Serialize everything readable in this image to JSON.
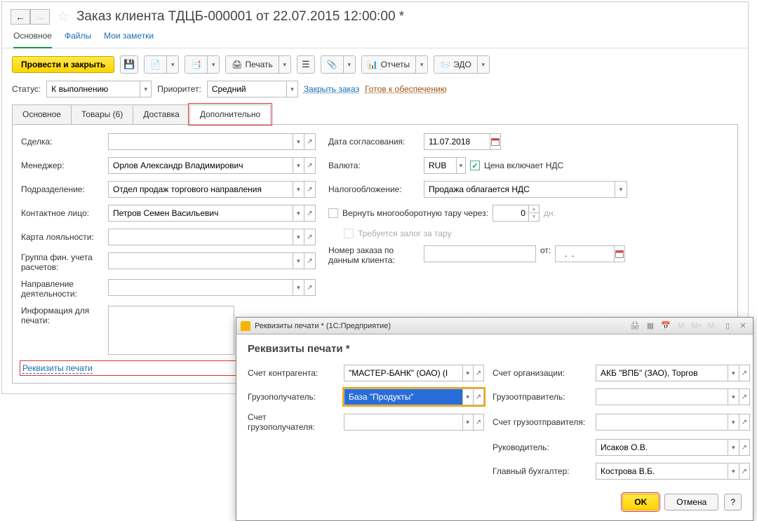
{
  "title": "Заказ клиента ТДЦБ-000001 от 22.07.2015 12:00:00 *",
  "navTabs": {
    "main": "Основное",
    "files": "Файлы",
    "notes": "Мои заметки"
  },
  "toolbar": {
    "postClose": "Провести и закрыть",
    "print": "Печать",
    "reports": "Отчеты",
    "edo": "ЭДО"
  },
  "statusRow": {
    "statusLabel": "Статус:",
    "statusValue": "К выполнению",
    "priorityLabel": "Приоритет:",
    "priorityValue": "Средний",
    "closeOrder": "Закрыть заказ",
    "readyToSupply": "Готов к обеспечению"
  },
  "contentTabs": {
    "main": "Основное",
    "goods": "Товары (6)",
    "delivery": "Доставка",
    "additional": "Дополнительно"
  },
  "form": {
    "deal": {
      "label": "Сделка:",
      "value": ""
    },
    "manager": {
      "label": "Менеджер:",
      "value": "Орлов Александр Владимирович"
    },
    "department": {
      "label": "Подразделение:",
      "value": "Отдел продаж торгового направления"
    },
    "contact": {
      "label": "Контактное лицо:",
      "value": "Петров Семен Васильевич"
    },
    "loyalty": {
      "label": "Карта лояльности:",
      "value": ""
    },
    "finGroup": {
      "label": "Группа фин. учета расчетов:",
      "value": ""
    },
    "activity": {
      "label": "Направление деятельности:",
      "value": ""
    },
    "printInfo": {
      "label": "Информация для печати:",
      "value": ""
    },
    "agreeDate": {
      "label": "Дата согласования:",
      "value": "11.07.2018"
    },
    "currency": {
      "label": "Валюта:",
      "value": "RUB",
      "vatLabel": "Цена включает НДС"
    },
    "taxation": {
      "label": "Налогообложение:",
      "value": "Продажа облагается НДС"
    },
    "returnTare": {
      "label": "Вернуть многооборотную тару через:",
      "value": "0",
      "unit": "дн."
    },
    "depositTare": {
      "label": "Требуется залог за тару"
    },
    "clientOrderNum": {
      "label": "Номер заказа по данным клиента:",
      "value": "",
      "fromLabel": "от:",
      "fromValue": "  .  .    "
    },
    "printDetails": "Реквизиты печати"
  },
  "modal": {
    "titlebar": "Реквизиты печати *  (1С:Предприятие)",
    "heading": "Реквизиты печати *",
    "counterAccount": {
      "label": "Счет контрагента:",
      "value": "\"МАСТЕР-БАНК\" (ОАО) (I"
    },
    "orgAccount": {
      "label": "Счет организации:",
      "value": "АКБ \"ВПБ\" (ЗАО), Торгов"
    },
    "consignee": {
      "label": "Грузополучатель:",
      "value": "База \"Продукты\""
    },
    "shipper": {
      "label": "Грузоотправитель:",
      "value": ""
    },
    "consigneeAccount": {
      "label": "Счет грузополучателя:",
      "value": ""
    },
    "shipperAccount": {
      "label": "Счет грузоотправителя:",
      "value": ""
    },
    "director": {
      "label": "Руководитель:",
      "value": "Исаков О.В."
    },
    "accountant": {
      "label": "Главный бухгалтер:",
      "value": "Кострова В.Б."
    },
    "ok": "OK",
    "cancel": "Отмена",
    "help": "?"
  }
}
